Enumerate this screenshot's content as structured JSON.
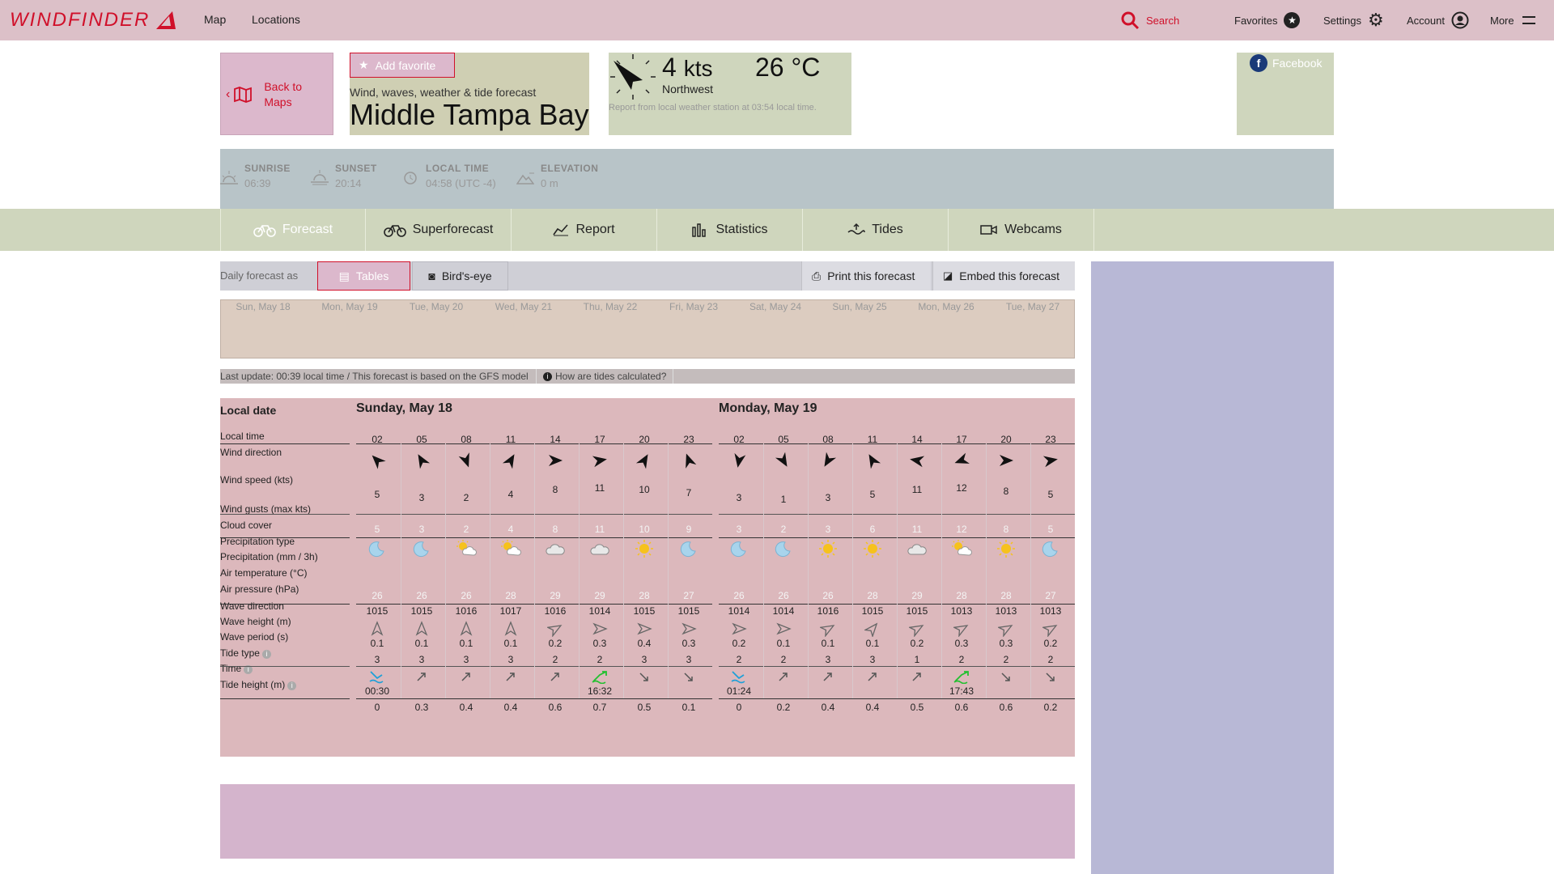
{
  "app": {
    "logo": "WINDFINDER"
  },
  "nav": {
    "map": "Map",
    "locations": "Locations"
  },
  "top_right": {
    "search": "Search",
    "favorites": "Favorites",
    "settings": "Settings",
    "account": "Account",
    "more": "More"
  },
  "back": {
    "label_1": "Back to",
    "label_2": "Maps"
  },
  "spot": {
    "add_favorite": "Add favorite",
    "subtitle": "Wind, waves, weather & tide forecast",
    "title": "Middle Tampa Bay"
  },
  "current": {
    "speed": "4",
    "speed_unit": "kts",
    "temp": "26",
    "temp_unit": "°C",
    "direction": "Northwest",
    "report": "Report from local weather station at 03:54 local time."
  },
  "social": {
    "facebook": "Facebook"
  },
  "sun": [
    {
      "label": "SUNRISE",
      "value": "06:39",
      "icon": "sunrise-icon"
    },
    {
      "label": "SUNSET",
      "value": "20:14",
      "icon": "sunset-icon"
    },
    {
      "label": "LOCAL TIME",
      "value": "04:58 (UTC -4)",
      "icon": "clock-icon"
    },
    {
      "label": "ELEVATION",
      "value": "0 m",
      "icon": "elevation-icon"
    }
  ],
  "tabs": [
    {
      "label": "Forecast",
      "icon": "bike-icon",
      "active": true
    },
    {
      "label": "Superforecast",
      "icon": "bike-icon"
    },
    {
      "label": "Report",
      "icon": "chart-icon"
    },
    {
      "label": "Statistics",
      "icon": "statistics-icon"
    },
    {
      "label": "Tides",
      "icon": "tides-icon"
    },
    {
      "label": "Webcams",
      "icon": "webcam-icon"
    }
  ],
  "toolbar": {
    "label": "Daily forecast as",
    "tables": "Tables",
    "birds_eye": "Bird's-eye",
    "print": "Print this forecast",
    "embed": "Embed this forecast"
  },
  "days": [
    "Sun, May 18",
    "Mon, May 19",
    "Tue, May 20",
    "Wed, May 21",
    "Thu, May 22",
    "Fri, May 23",
    "Sat, May 24",
    "Sun, May 25",
    "Mon, May 26",
    "Tue, May 27"
  ],
  "update": {
    "text": "Last update: 00:39 local time / This forecast is based on the GFS model",
    "tide_help": "How are tides calculated?"
  },
  "table": {
    "labels": {
      "local_date": "Local date",
      "local_time": "Local time",
      "wind_direction": "Wind direction",
      "wind_speed": "Wind speed (kts)",
      "wind_gusts": "Wind gusts (max kts)",
      "cloud_cover": "Cloud cover",
      "precip_type": "Precipitation type",
      "precip": "Precipitation (mm / 3h)",
      "air_temp": "Air temperature (°C)",
      "air_pressure": "Air pressure (hPa)",
      "wave_direction": "Wave direction",
      "wave_height": "Wave height (m)",
      "wave_period": "Wave period (s)",
      "tide_type": "Tide type",
      "tide_time": "Time",
      "tide_height": "Tide height (m)"
    },
    "day_titles": [
      "Sunday, May 18",
      "Monday, May 19"
    ],
    "hours": [
      "02",
      "05",
      "08",
      "11",
      "14",
      "17",
      "20",
      "23",
      "02",
      "05",
      "08",
      "11",
      "14",
      "17",
      "20",
      "23"
    ],
    "wind_dir_deg": [
      315,
      330,
      160,
      30,
      90,
      80,
      30,
      340,
      190,
      150,
      210,
      330,
      280,
      250,
      90,
      80
    ],
    "wind_speed": [
      "5",
      "3",
      "2",
      "4",
      "8",
      "11",
      "10",
      "7",
      "3",
      "1",
      "3",
      "5",
      "11",
      "12",
      "8",
      "5"
    ],
    "wind_gusts": [
      "5",
      "3",
      "2",
      "4",
      "8",
      "11",
      "10",
      "9",
      "3",
      "2",
      "3",
      "6",
      "11",
      "12",
      "8",
      "5"
    ],
    "clouds": [
      "moon",
      "moon",
      "sun-cloud",
      "sun-cloud",
      "cloud",
      "cloud",
      "sun",
      "moon",
      "moon",
      "moon",
      "sun",
      "sun",
      "cloud",
      "sun-cloud",
      "sun",
      "moon"
    ],
    "air_temp": [
      "26",
      "26",
      "26",
      "28",
      "29",
      "29",
      "28",
      "27",
      "26",
      "26",
      "26",
      "28",
      "29",
      "28",
      "28",
      "27"
    ],
    "air_pressure": [
      "1015",
      "1015",
      "1016",
      "1017",
      "1016",
      "1014",
      "1015",
      "1015",
      "1014",
      "1014",
      "1016",
      "1015",
      "1015",
      "1013",
      "1013",
      "1013"
    ],
    "wave_dir_deg": [
      0,
      0,
      0,
      0,
      60,
      90,
      90,
      90,
      90,
      90,
      60,
      40,
      60,
      60,
      60,
      60
    ],
    "wave_height": [
      "0.1",
      "0.1",
      "0.1",
      "0.1",
      "0.2",
      "0.3",
      "0.4",
      "0.3",
      "0.2",
      "0.1",
      "0.1",
      "0.1",
      "0.2",
      "0.3",
      "0.3",
      "0.2"
    ],
    "wave_period": [
      "3",
      "3",
      "3",
      "3",
      "2",
      "2",
      "3",
      "3",
      "2",
      "2",
      "3",
      "3",
      "1",
      "2",
      "2",
      "2"
    ],
    "tide_type": [
      "low",
      "up",
      "up",
      "up",
      "up",
      "high",
      "down",
      "down",
      "low",
      "up",
      "up",
      "up",
      "up",
      "high",
      "down",
      "down"
    ],
    "tide_time": [
      "00:30",
      "",
      "",
      "",
      "",
      "16:32",
      "",
      "",
      "01:24",
      "",
      "",
      "",
      "",
      "17:43",
      "",
      ""
    ],
    "tide_height": [
      "0",
      "0.3",
      "0.4",
      "0.4",
      "0.6",
      "0.7",
      "0.5",
      "0.1",
      "0",
      "0.2",
      "0.4",
      "0.4",
      "0.5",
      "0.6",
      "0.6",
      "0.2"
    ]
  },
  "colors": {
    "brand": "#d0102a",
    "tide_low": "#1ea0d8",
    "tide_high": "#22c030"
  }
}
